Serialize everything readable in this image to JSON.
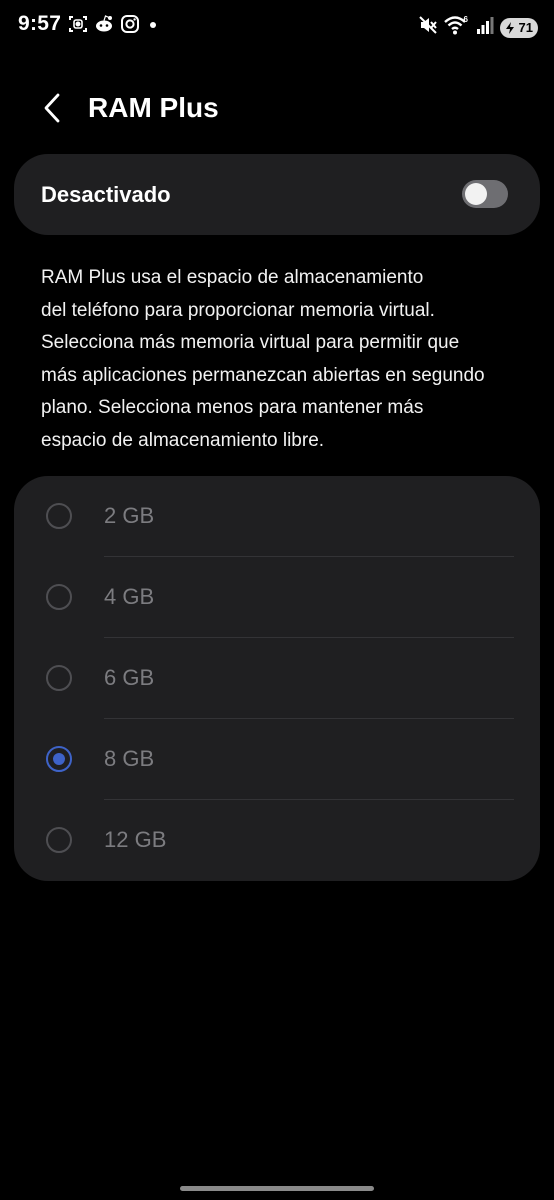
{
  "status_bar": {
    "time": "9:57",
    "battery": "71",
    "wifi_badge": "6",
    "left_icons": [
      "screenshot-icon",
      "reddit-icon",
      "instagram-icon",
      "dot-icon"
    ],
    "right_icons": [
      "mute-icon",
      "wifi-icon",
      "signal-icon",
      "battery-icon"
    ]
  },
  "header": {
    "title": "RAM Plus",
    "back_icon": "chevron-left-icon"
  },
  "toggle": {
    "label": "Desactivado",
    "state": "off"
  },
  "description": {
    "lines": [
      "RAM Plus usa el espacio de almacenamiento",
      "del teléfono para proporcionar memoria virtual.",
      "Selecciona más memoria virtual para permitir que",
      "más aplicaciones permanezcan abiertas en segundo",
      "plano. Selecciona menos para mantener más",
      "espacio de almacenamiento libre."
    ]
  },
  "options": [
    {
      "label": "2 GB",
      "selected": false
    },
    {
      "label": "4 GB",
      "selected": false
    },
    {
      "label": "6 GB",
      "selected": false
    },
    {
      "label": "8 GB",
      "selected": true
    },
    {
      "label": "12 GB",
      "selected": false
    }
  ],
  "colors": {
    "background": "#000000",
    "card": "#1f1f21",
    "accent": "#3e63c8",
    "disabled_text": "#7c7c80"
  }
}
